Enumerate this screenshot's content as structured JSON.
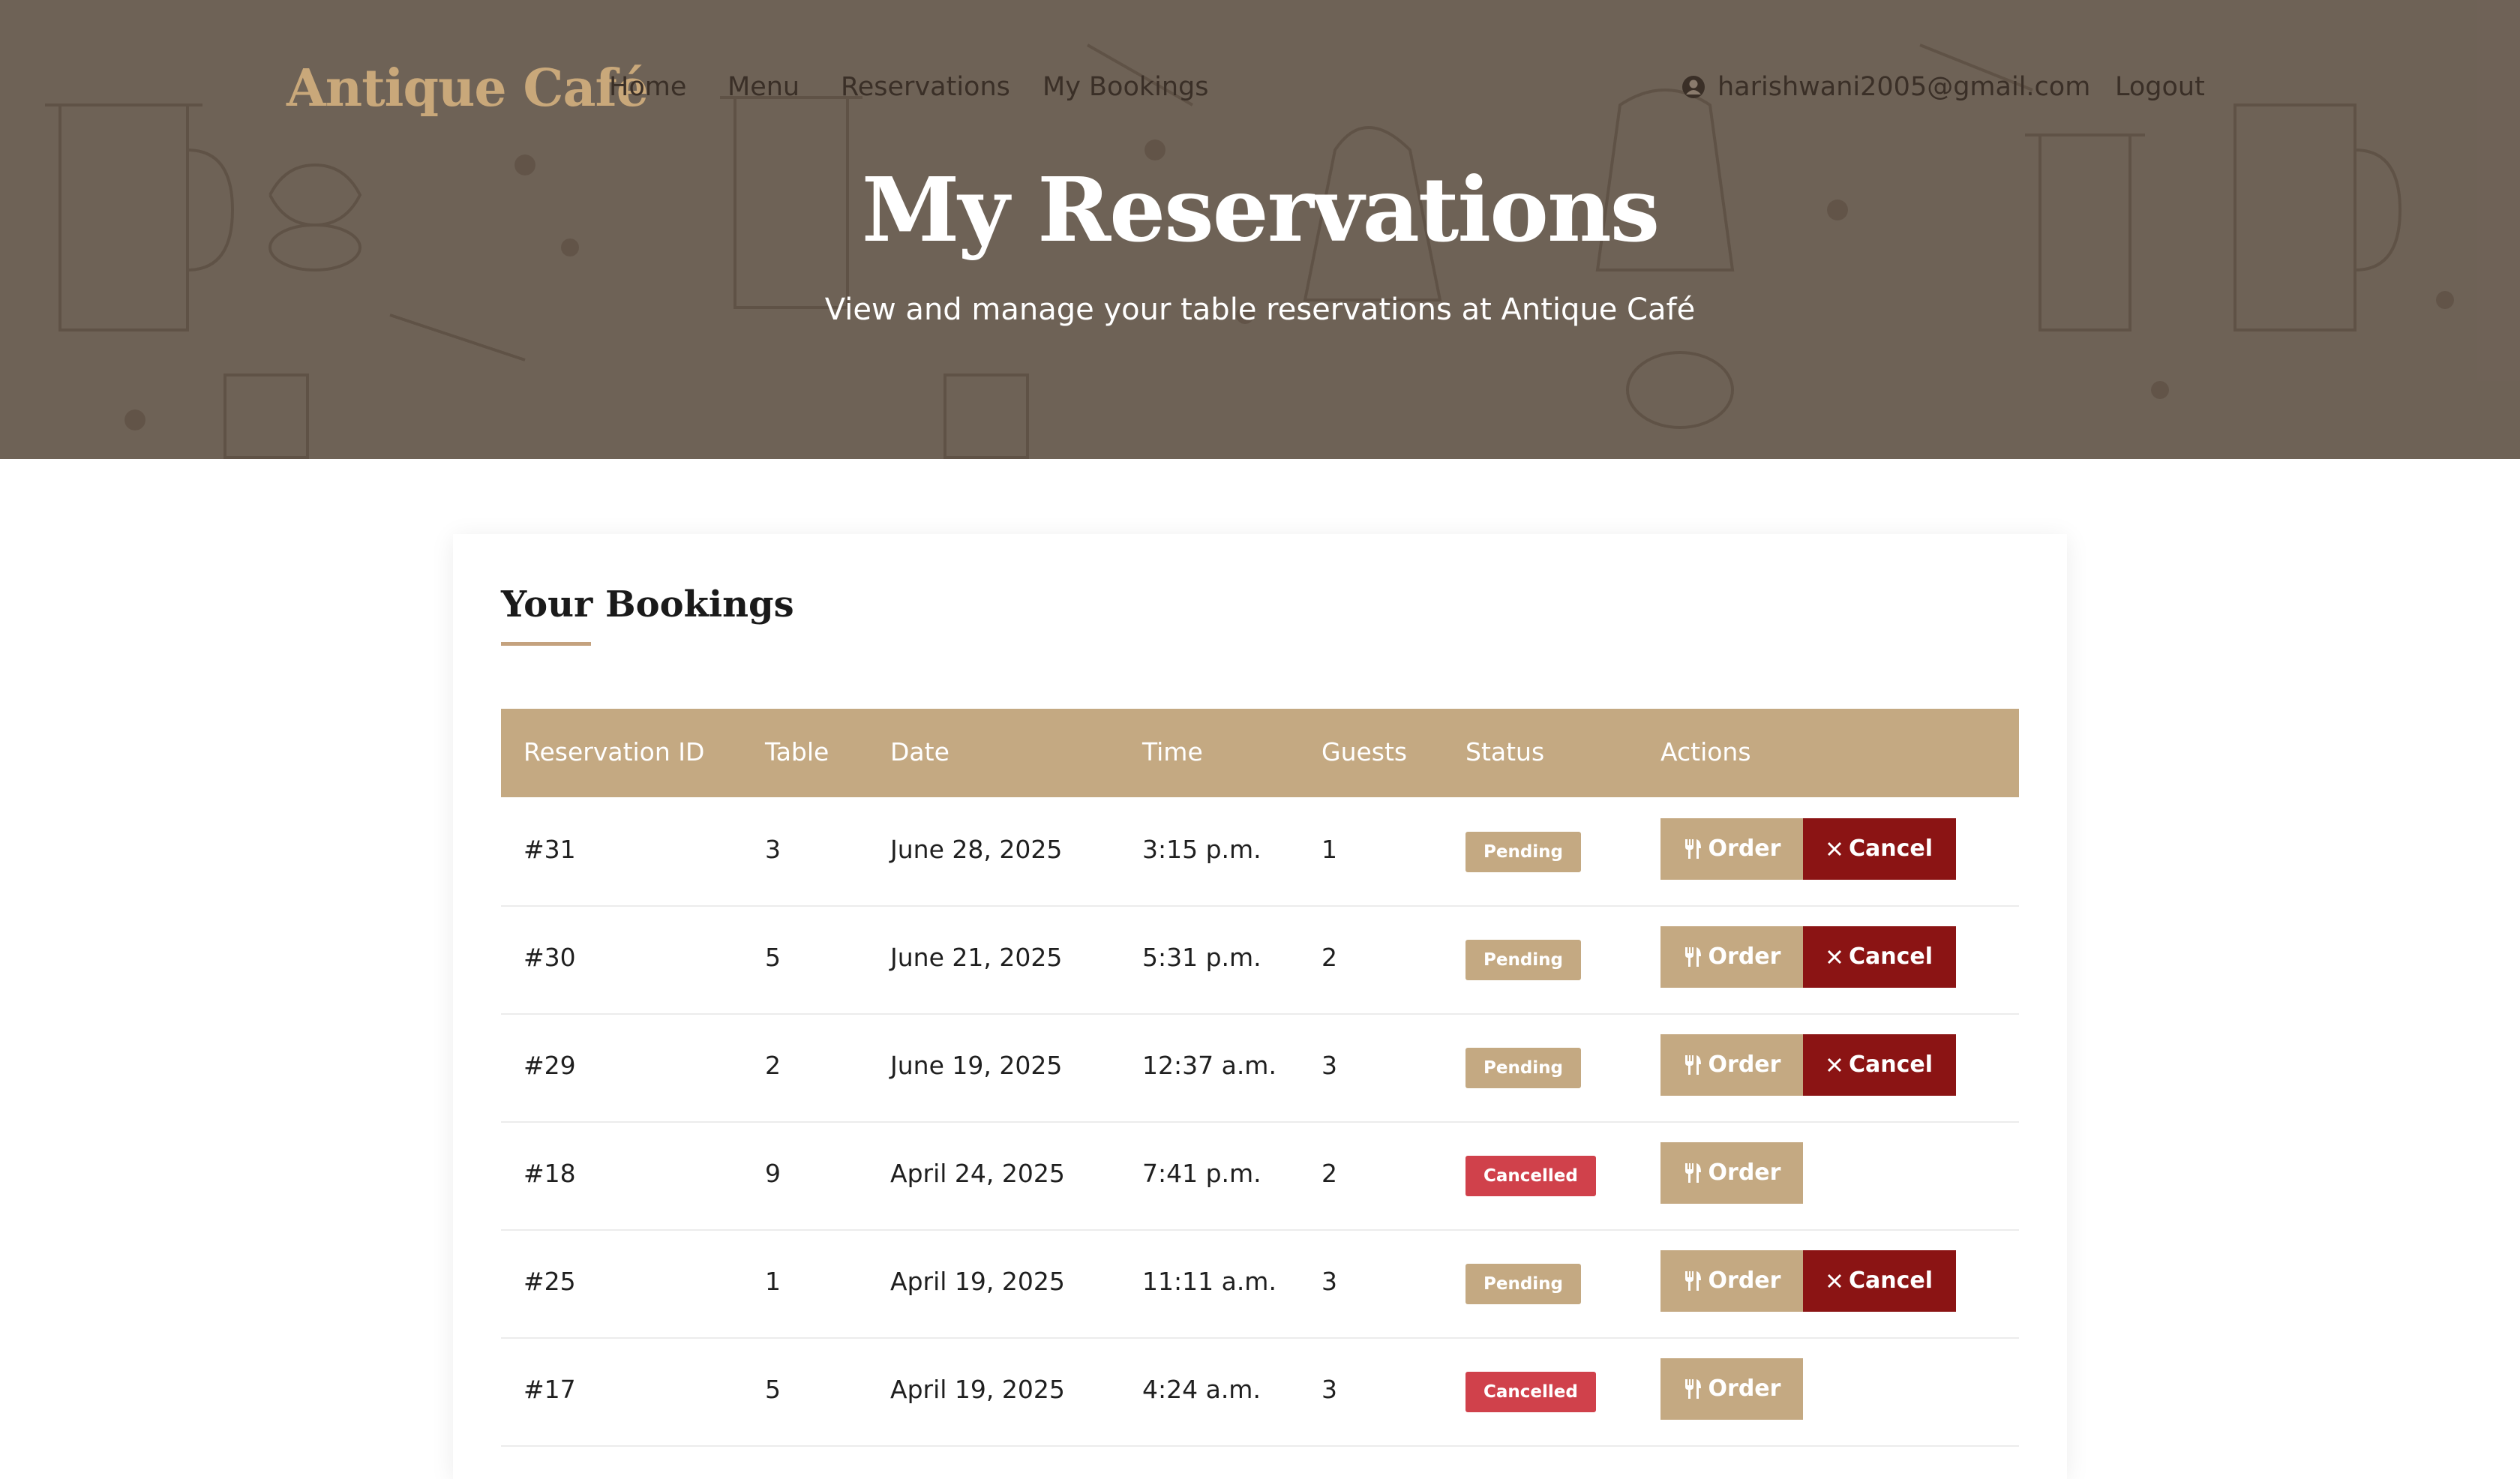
{
  "brand": "Antique Café",
  "nav": {
    "links": [
      "Home",
      "Menu",
      "Reservations",
      "My Bookings"
    ],
    "user_email": "harishwani2005@gmail.com",
    "logout": "Logout"
  },
  "hero": {
    "title": "My Reservations",
    "subtitle": "View and manage your table reservations at Antique Café"
  },
  "bookings": {
    "title": "Your Bookings",
    "columns": [
      "Reservation ID",
      "Table",
      "Date",
      "Time",
      "Guests",
      "Status",
      "Actions"
    ],
    "order_label": "Order",
    "cancel_label": "Cancel",
    "rows": [
      {
        "id": "#31",
        "table": "3",
        "date": "June 28, 2025",
        "time": "3:15 p.m.",
        "guests": "1",
        "status": "Pending"
      },
      {
        "id": "#30",
        "table": "5",
        "date": "June 21, 2025",
        "time": "5:31 p.m.",
        "guests": "2",
        "status": "Pending"
      },
      {
        "id": "#29",
        "table": "2",
        "date": "June 19, 2025",
        "time": "12:37 a.m.",
        "guests": "3",
        "status": "Pending"
      },
      {
        "id": "#18",
        "table": "9",
        "date": "April 24, 2025",
        "time": "7:41 p.m.",
        "guests": "2",
        "status": "Cancelled"
      },
      {
        "id": "#25",
        "table": "1",
        "date": "April 19, 2025",
        "time": "11:11 a.m.",
        "guests": "3",
        "status": "Pending"
      },
      {
        "id": "#17",
        "table": "5",
        "date": "April 19, 2025",
        "time": "4:24 a.m.",
        "guests": "3",
        "status": "Cancelled"
      }
    ]
  },
  "colors": {
    "accent": "#c4a982",
    "cancel": "#8b1414",
    "cancelled_badge": "#d0414b",
    "brand": "#c9a87a"
  }
}
